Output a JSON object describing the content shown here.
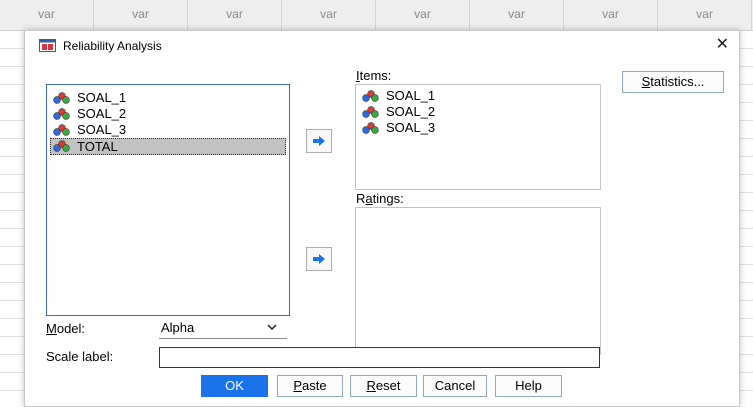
{
  "background": {
    "column_headers": [
      "var",
      "var",
      "var",
      "var",
      "var",
      "var",
      "var",
      "var"
    ]
  },
  "dialog": {
    "title": "Reliability Analysis",
    "close_glyph": "✕",
    "source_variables": [
      {
        "name": "SOAL_1",
        "icon": "scale-variable-icon",
        "selected": false
      },
      {
        "name": "SOAL_2",
        "icon": "scale-variable-icon",
        "selected": false
      },
      {
        "name": "SOAL_3",
        "icon": "scale-variable-icon",
        "selected": false
      },
      {
        "name": "TOTAL",
        "icon": "scale-variable-icon",
        "selected": true
      }
    ],
    "items": {
      "label_mnemonic": "I",
      "label_rest": "tems:",
      "variables": [
        "SOAL_1",
        "SOAL_2",
        "SOAL_3"
      ]
    },
    "ratings": {
      "label_prefix": "R",
      "label_mnemonic": "a",
      "label_rest": "tings:",
      "variables": []
    },
    "statistics_button": {
      "mnemonic": "S",
      "rest": "tatistics..."
    },
    "model": {
      "label_mnemonic": "M",
      "label_rest": "odel:",
      "value": "Alpha"
    },
    "scale_label": {
      "label": "Scale label:",
      "value": ""
    },
    "buttons": {
      "ok": "OK",
      "paste": {
        "mnemonic": "P",
        "rest": "aste"
      },
      "reset": {
        "mnemonic": "R",
        "rest": "eset"
      },
      "cancel": "Cancel",
      "help": "Help"
    },
    "colors": {
      "accent": "#1a73e8",
      "selection": "#c2c2c2",
      "arrow": "#1a73e8"
    }
  }
}
